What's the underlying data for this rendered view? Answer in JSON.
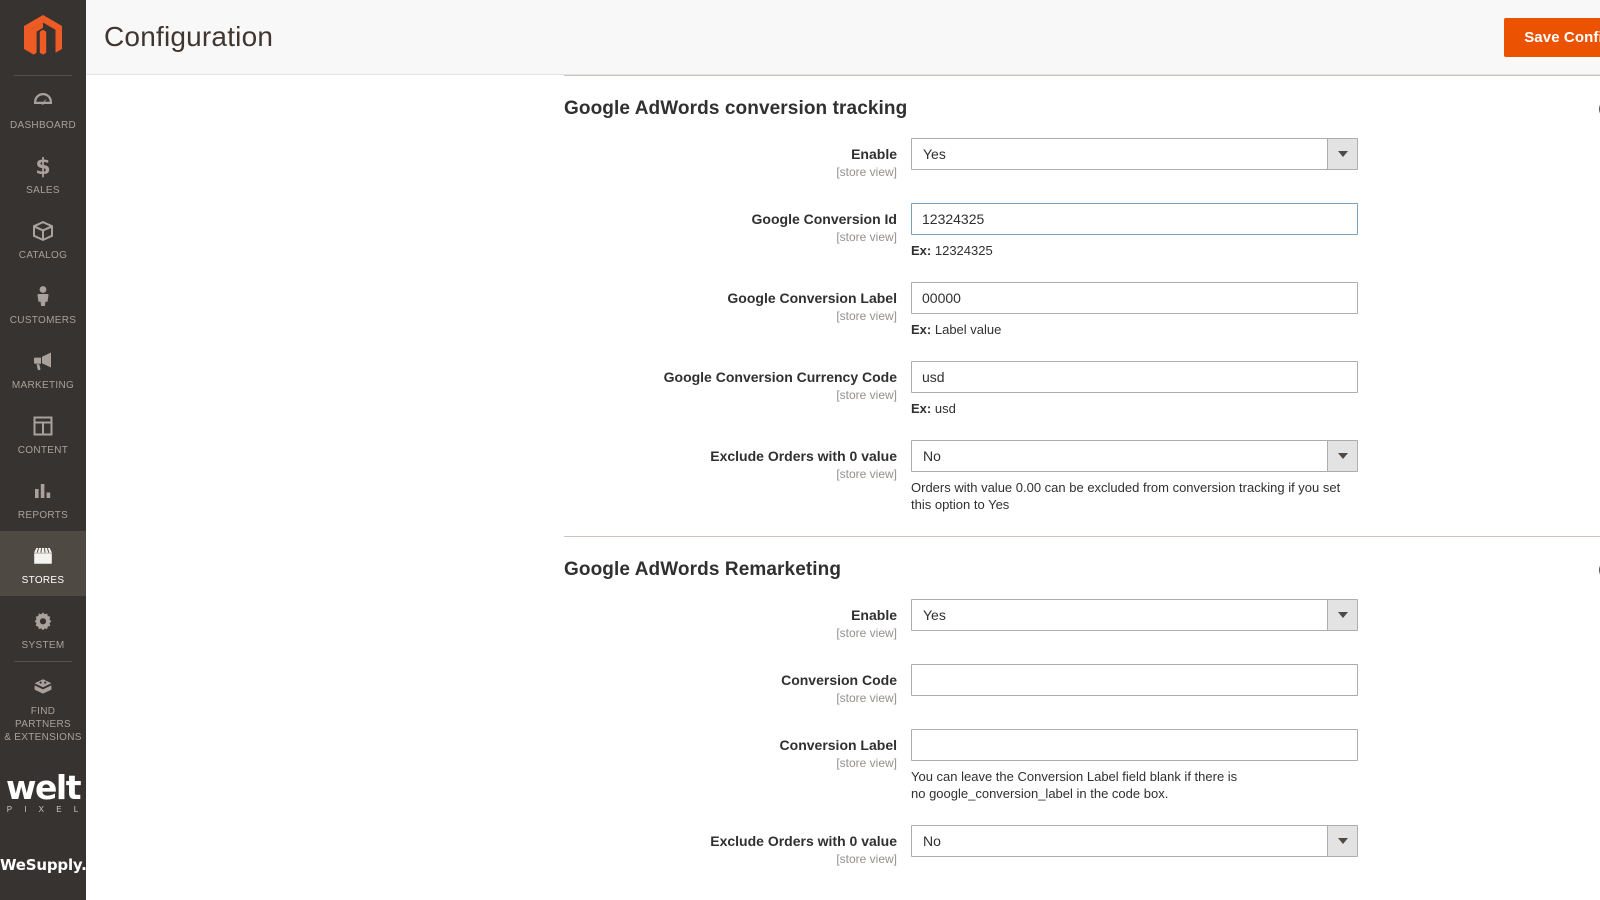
{
  "sidebar": {
    "logo_icon": "magento-logo",
    "items": [
      {
        "label": "DASHBOARD",
        "icon": "dashboard-icon",
        "active": false
      },
      {
        "label": "SALES",
        "icon": "dollar-icon",
        "active": false
      },
      {
        "label": "CATALOG",
        "icon": "box-icon",
        "active": false
      },
      {
        "label": "CUSTOMERS",
        "icon": "person-icon",
        "active": false
      },
      {
        "label": "MARKETING",
        "icon": "megaphone-icon",
        "active": false
      },
      {
        "label": "CONTENT",
        "icon": "layout-icon",
        "active": false
      },
      {
        "label": "REPORTS",
        "icon": "bar-chart-icon",
        "active": false
      },
      {
        "label": "STORES",
        "icon": "store-icon",
        "active": true
      },
      {
        "label": "SYSTEM",
        "icon": "gear-icon",
        "active": false
      },
      {
        "label": "FIND PARTNERS\n& EXTENSIONS",
        "icon": "extension-box-icon",
        "active": false
      }
    ],
    "brand_welt": "welt",
    "brand_welt_sub": "P I X E L",
    "brand_wesupply": "WeSupply."
  },
  "header": {
    "title": "Configuration",
    "save_label": "Save Config",
    "accent_color": "#eb5202"
  },
  "sections": [
    {
      "title": "Google AdWords conversion tracking",
      "collapse_icon": "chevron-up-circle-icon",
      "fields": [
        {
          "label": "Enable",
          "scope": "[store view]",
          "type": "select",
          "value": "Yes",
          "options": [
            "Yes",
            "No"
          ],
          "note": ""
        },
        {
          "label": "Google Conversion Id",
          "scope": "[store view]",
          "type": "text",
          "value": "12324325",
          "placeholder": "",
          "focused": true,
          "note_prefix": "Ex:",
          "note": "12324325"
        },
        {
          "label": "Google Conversion Label",
          "scope": "[store view]",
          "type": "text",
          "value": "00000",
          "placeholder": "",
          "focused": false,
          "note_prefix": "Ex:",
          "note": "Label value"
        },
        {
          "label": "Google Conversion Currency Code",
          "scope": "[store view]",
          "type": "text",
          "value": "usd",
          "placeholder": "",
          "focused": false,
          "note_prefix": "Ex:",
          "note": "usd"
        },
        {
          "label": "Exclude Orders with 0 value",
          "scope": "[store view]",
          "type": "select",
          "value": "No",
          "options": [
            "Yes",
            "No"
          ],
          "note": "Orders with value 0.00 can be excluded from conversion tracking if you set this option to Yes"
        }
      ]
    },
    {
      "title": "Google AdWords Remarketing",
      "collapse_icon": "chevron-up-circle-icon",
      "fields": [
        {
          "label": "Enable",
          "scope": "[store view]",
          "type": "select",
          "value": "Yes",
          "options": [
            "Yes",
            "No"
          ],
          "note": ""
        },
        {
          "label": "Conversion Code",
          "scope": "[store view]",
          "type": "text",
          "value": "",
          "placeholder": "",
          "focused": false,
          "note": ""
        },
        {
          "label": "Conversion Label",
          "scope": "[store view]",
          "type": "text",
          "value": "",
          "placeholder": "",
          "focused": false,
          "note": "You can leave the Conversion Label field blank if there is no google_conversion_label in the code box."
        },
        {
          "label": "Exclude Orders with 0 value",
          "scope": "[store view]",
          "type": "select",
          "value": "No",
          "options": [
            "Yes",
            "No"
          ],
          "note": ""
        }
      ]
    }
  ]
}
